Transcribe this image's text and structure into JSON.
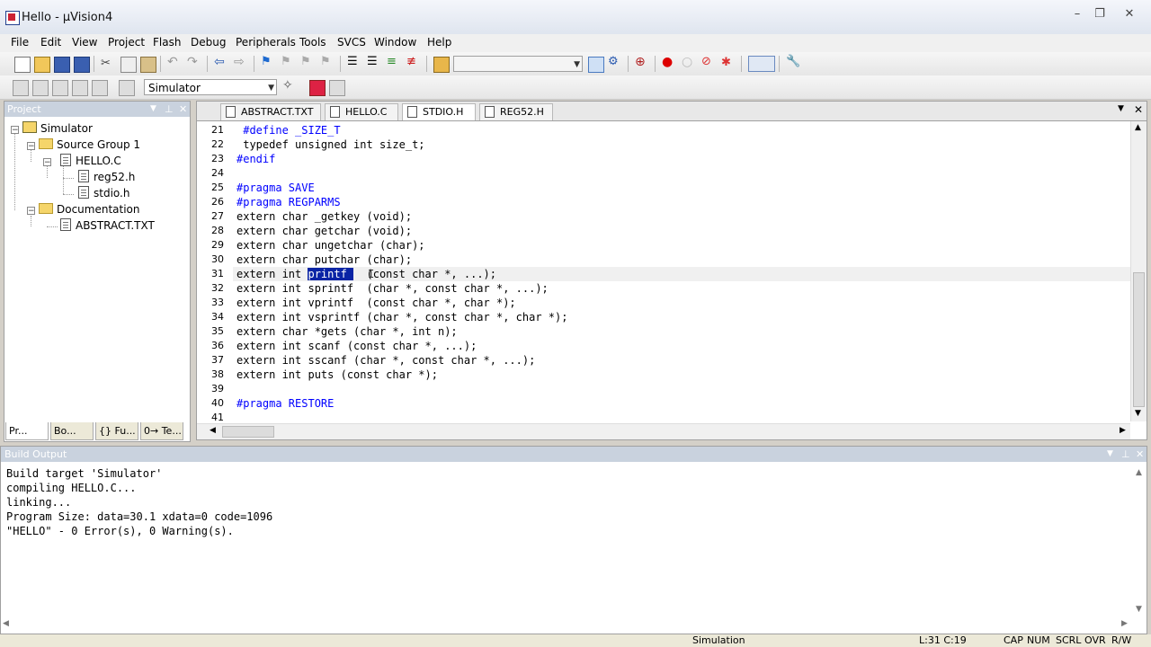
{
  "window": {
    "title": "Hello - µVision4",
    "minimize": "–",
    "restore": "❐",
    "close": "✕"
  },
  "menu": [
    {
      "label": "File",
      "key": "F"
    },
    {
      "label": "Edit",
      "key": "E"
    },
    {
      "label": "View",
      "key": "V"
    },
    {
      "label": "Project",
      "key": "P"
    },
    {
      "label": "Flash",
      "key": "F"
    },
    {
      "label": "Debug",
      "key": "D"
    },
    {
      "label": "Peripherals",
      "key": "P"
    },
    {
      "label": "Tools",
      "key": "T"
    },
    {
      "label": "SVCS",
      "key": "S"
    },
    {
      "label": "Window",
      "key": "W"
    },
    {
      "label": "Help",
      "key": "H"
    }
  ],
  "toolbar2": {
    "target_select": "Simulator"
  },
  "project_panel": {
    "title": "Project",
    "tree": {
      "root": "Simulator",
      "group1": "Source Group 1",
      "file1": "HELLO.C",
      "dep1": "reg52.h",
      "dep2": "stdio.h",
      "group2": "Documentation",
      "doc1": "ABSTRACT.TXT"
    },
    "tabs": [
      "Pr...",
      "Bo...",
      "{} Fu...",
      "0→ Te..."
    ]
  },
  "editor": {
    "tabs": [
      "ABSTRACT.TXT",
      "HELLO.C",
      "STDIO.H",
      "REG52.H"
    ],
    "active_tab": "STDIO.H",
    "lines": [
      {
        "n": "21",
        "text": " #define _SIZE_T"
      },
      {
        "n": "22",
        "text": " typedef unsigned int size_t;"
      },
      {
        "n": "23",
        "text": "#endif"
      },
      {
        "n": "24",
        "text": ""
      },
      {
        "n": "25",
        "text": "#pragma SAVE"
      },
      {
        "n": "26",
        "text": "#pragma REGPARMS"
      },
      {
        "n": "27",
        "text": "extern char _getkey (void);"
      },
      {
        "n": "28",
        "text": "extern char getchar (void);"
      },
      {
        "n": "29",
        "text": "extern char ungetchar (char);"
      },
      {
        "n": "30",
        "text": "extern char putchar (char);"
      },
      {
        "n": "31",
        "pre": "extern int ",
        "sel": "printf ",
        "post": "  (const char *, ...);"
      },
      {
        "n": "32",
        "text": "extern int sprintf  (char *, const char *, ...);"
      },
      {
        "n": "33",
        "text": "extern int vprintf  (const char *, char *);"
      },
      {
        "n": "34",
        "text": "extern int vsprintf (char *, const char *, char *);"
      },
      {
        "n": "35",
        "text": "extern char *gets (char *, int n);"
      },
      {
        "n": "36",
        "text": "extern int scanf (const char *, ...);"
      },
      {
        "n": "37",
        "text": "extern int sscanf (char *, const char *, ...);"
      },
      {
        "n": "38",
        "text": "extern int puts (const char *);"
      },
      {
        "n": "39",
        "text": ""
      },
      {
        "n": "40",
        "text": "#pragma RESTORE"
      },
      {
        "n": "41",
        "text": ""
      }
    ]
  },
  "build_output": {
    "title": "Build Output",
    "lines": [
      "Build target 'Simulator'",
      "compiling HELLO.C...",
      "linking...",
      "Program Size: data=30.1 xdata=0 code=1096",
      "\"HELLO\" - 0 Error(s), 0 Warning(s)."
    ]
  },
  "status": {
    "mode": "Simulation",
    "position": "L:31 C:19",
    "indicators": [
      "CAP",
      "NUM",
      "SCRL",
      "OVR",
      "R/W"
    ]
  },
  "colors": {
    "accent": "#0a24a5",
    "preprocessor": "#0000ff",
    "panel_header": "#c9d2de"
  }
}
